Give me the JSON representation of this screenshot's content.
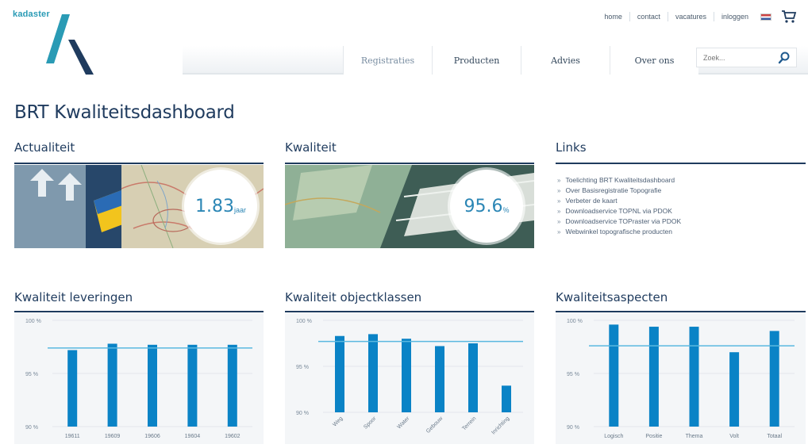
{
  "header": {
    "logo_text": "kadaster",
    "topnav": [
      "home",
      "contact",
      "vacatures",
      "inloggen"
    ],
    "mainnav": [
      "Registraties",
      "Producten",
      "Advies",
      "Over ons"
    ],
    "search_placeholder": "Zoek..."
  },
  "page_title": "BRT Kwaliteitsdashboard",
  "actualiteit": {
    "heading": "Actualiteit",
    "value": "1.83",
    "unit": "jaar"
  },
  "kwaliteit": {
    "heading": "Kwaliteit",
    "value": "95.6",
    "unit": "%"
  },
  "links": {
    "heading": "Links",
    "items": [
      "Toelichting BRT Kwaliteitsdashboard",
      "Over Basisregistratie Topografie",
      "Verbeter de kaart",
      "Downloadservice TOPNL via PDOK",
      "Downloadservice TOPraster via PDOK",
      "Webwinkel topografische producten"
    ]
  },
  "colors": {
    "accent": "#0a83c6",
    "heading": "#1f3b5e",
    "target_line": "#5ab8e0"
  },
  "chart_data": [
    {
      "type": "bar",
      "title": "Kwaliteit leveringen",
      "categories": [
        "19611",
        "19609",
        "19606",
        "19604",
        "19602"
      ],
      "values": [
        97.2,
        97.8,
        97.7,
        97.7,
        97.7
      ],
      "target": 97.4,
      "ylim": [
        90,
        100
      ],
      "yticks": [
        "100 %",
        "95 %",
        "90 %"
      ]
    },
    {
      "type": "bar",
      "title": "Kwaliteit objectklassen",
      "categories": [
        "Weg",
        "Spoor",
        "Water",
        "Gebouw",
        "Terrein",
        "Inrichting"
      ],
      "values": [
        98.3,
        98.5,
        98.0,
        97.2,
        97.5,
        92.9
      ],
      "target": 97.7,
      "ylim": [
        90,
        100
      ],
      "yticks": [
        "100 %",
        "95 %",
        "90 %"
      ]
    },
    {
      "type": "bar",
      "title": "Kwaliteitsaspecten",
      "categories": [
        "Logisch",
        "Positie",
        "Thema",
        "Volt",
        "Totaal"
      ],
      "values": [
        99.6,
        99.4,
        99.4,
        97.0,
        99.0
      ],
      "target": 97.6,
      "ylim": [
        90,
        100
      ],
      "yticks": [
        "100 %",
        "95 %",
        "90 %"
      ]
    }
  ]
}
